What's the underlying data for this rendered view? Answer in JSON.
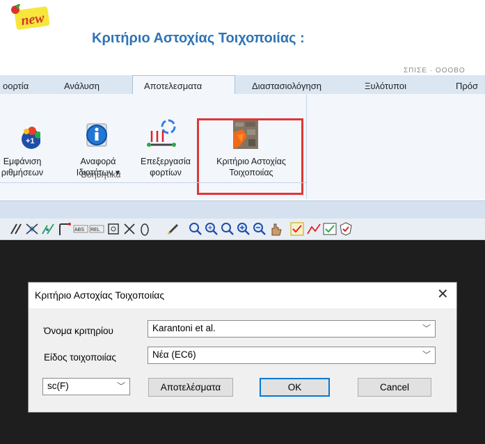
{
  "header": {
    "badge": "new",
    "title": "Κριτήριο Αστοχίας Τοιχοποιίας :",
    "top_cut_text": "ΣΠΙΣΕ · ΟΟΟΒΟ"
  },
  "ribbon": {
    "tabs": [
      "οορτία",
      "Ανάλυση",
      "Αποτελεσματα",
      "Διαστασιολόγηση",
      "Ξυλότυποι",
      "Πρόσ"
    ],
    "active_tab": "Αποτελεσματα",
    "buttons": [
      {
        "line1": "Εμφάνιση",
        "line2": "ριθμήσεων"
      },
      {
        "line1": "Αναφορά",
        "line2": "Ιδιοτήτων ▾"
      },
      {
        "line1": "Επεξεργασία",
        "line2": "φορτίων"
      },
      {
        "line1": "Κριτήριο Αστοχίας",
        "line2": "Τοιχοποιίας"
      }
    ],
    "group_label": "Βοηθητικά"
  },
  "dialog": {
    "title": "Κριτήριο Αστοχίας Τοιχοποιίας",
    "close": "✕",
    "criterion_label": "Όνομα κριτηρίου",
    "criterion_value": "Karantoni et al.",
    "masonry_label": "Είδος τοιχοποιίας",
    "masonry_value": "Νέα (EC6)",
    "sc_value": "sc(F)",
    "results_button": "Αποτελέσματα",
    "ok_button": "OK",
    "cancel_button": "Cancel"
  },
  "colors": {
    "title": "#2e74b5",
    "highlight": "#e03535",
    "dark_background": "#1e1e1e",
    "ribbon": "#f3f7fc"
  }
}
